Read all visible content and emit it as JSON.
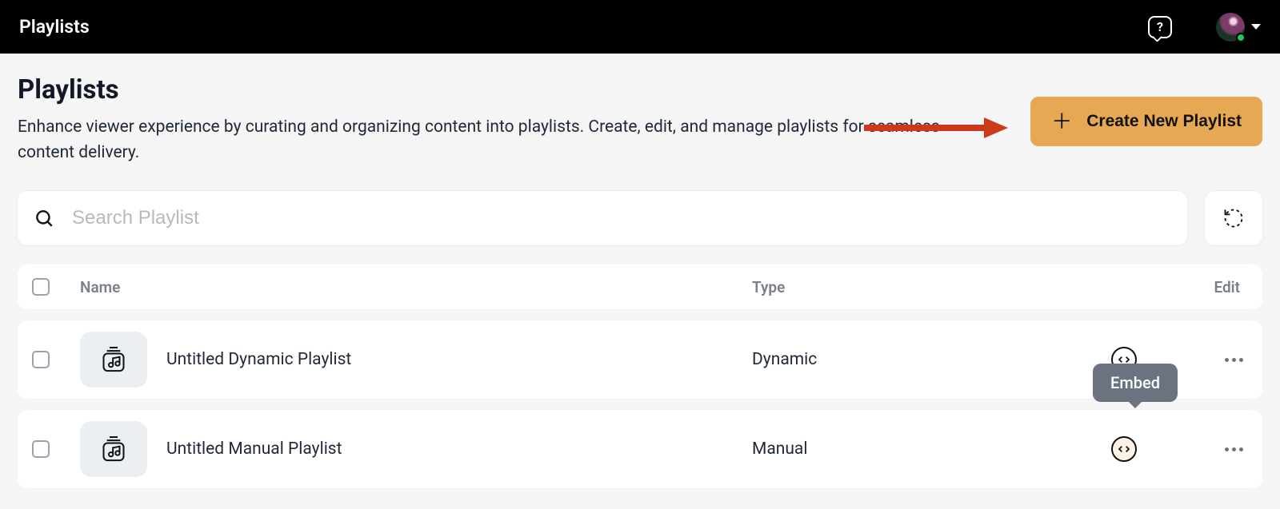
{
  "topbar": {
    "title": "Playlists"
  },
  "page": {
    "title": "Playlists",
    "description": "Enhance viewer experience by curating and organizing content into playlists. Create, edit, and manage playlists for seamless content delivery.",
    "create_label": "Create New Playlist"
  },
  "search": {
    "placeholder": "Search Playlist"
  },
  "table": {
    "headers": {
      "name": "Name",
      "type": "Type",
      "edit": "Edit"
    },
    "rows": [
      {
        "name": "Untitled Dynamic Playlist",
        "type": "Dynamic"
      },
      {
        "name": "Untitled Manual Playlist",
        "type": "Manual"
      }
    ]
  },
  "tooltip": {
    "embed": "Embed"
  }
}
